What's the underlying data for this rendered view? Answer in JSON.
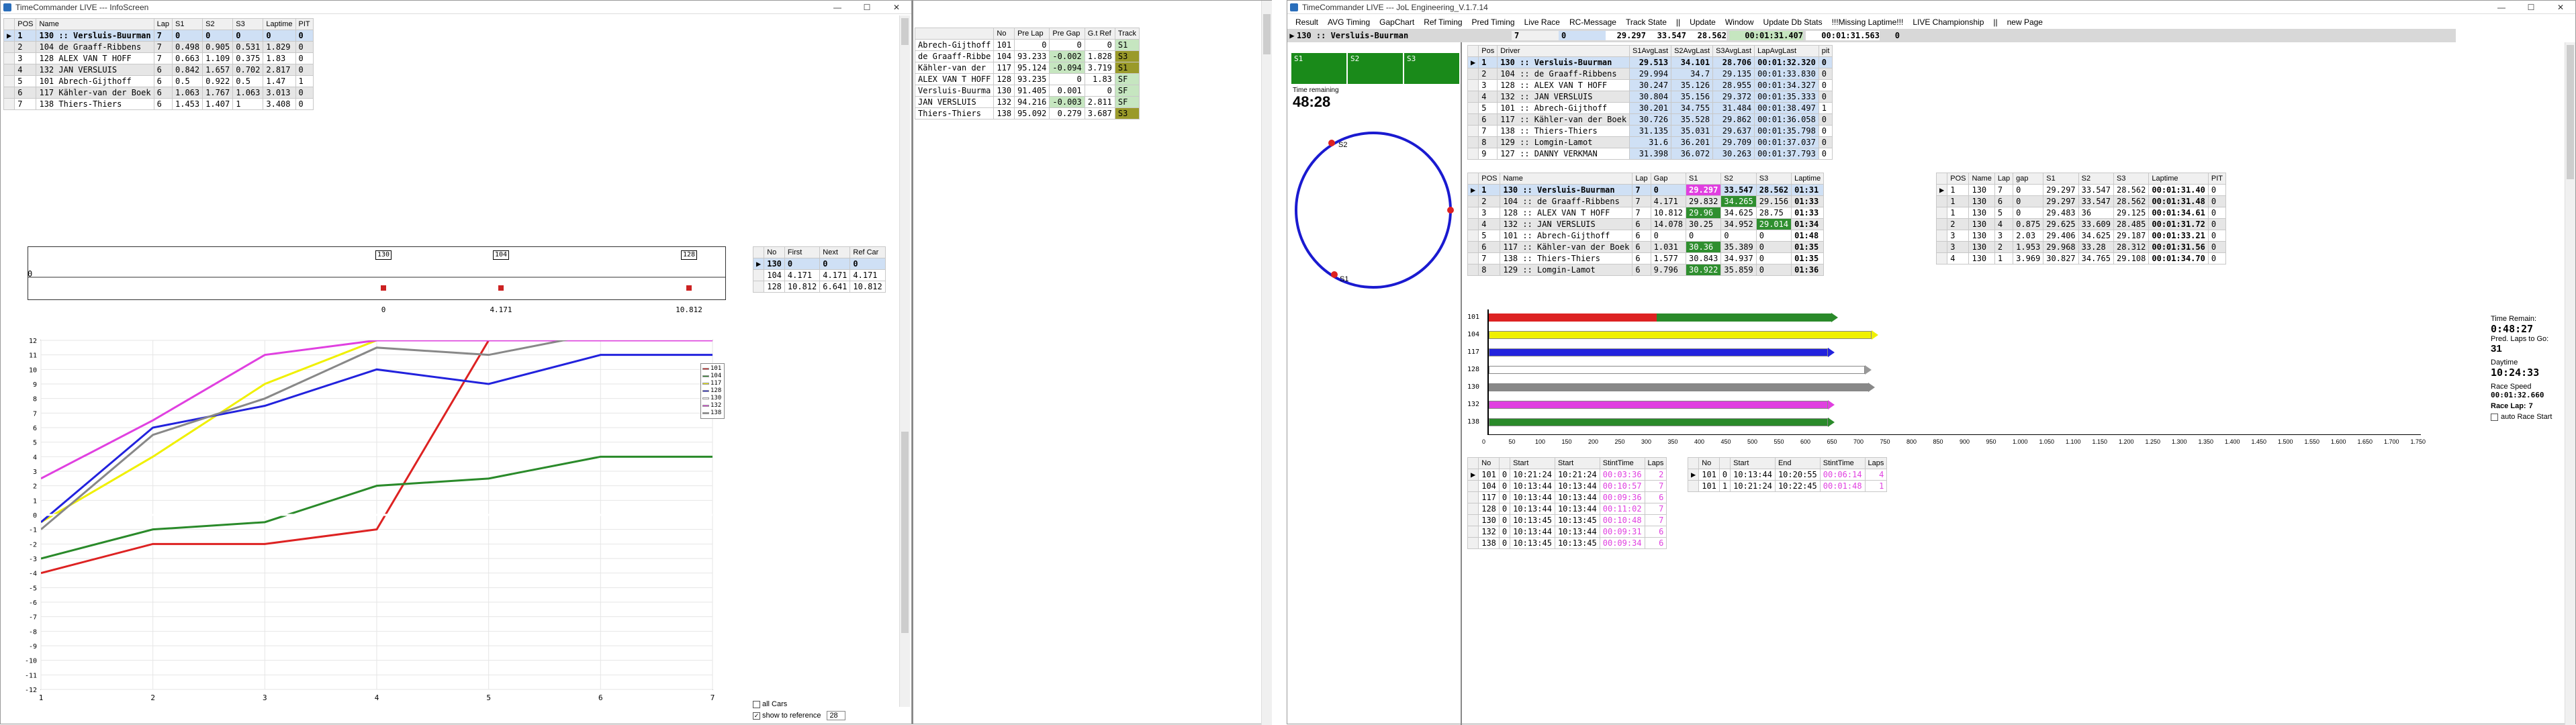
{
  "left_window": {
    "title": "TimeCommander LIVE --- InfoScreen",
    "results_headers": [
      "POS",
      "Name",
      "Lap",
      "S1",
      "S2",
      "S3",
      "Laptime",
      "PIT"
    ],
    "results_rows": [
      [
        "1",
        "130 :: Versluis-Buurman",
        "7",
        "0",
        "0",
        "0",
        "0",
        "0"
      ],
      [
        "2",
        "104 de Graaff-Ribbens",
        "7",
        "0.498",
        "0.905",
        "0.531",
        "1.829",
        "0"
      ],
      [
        "3",
        "128 ALEX VAN T HOFF",
        "7",
        "0.663",
        "1.109",
        "0.375",
        "1.83",
        "0"
      ],
      [
        "4",
        "132 JAN VERSLUIS",
        "6",
        "0.842",
        "1.657",
        "0.702",
        "2.817",
        "0"
      ],
      [
        "5",
        "101 Abrech-Gijthoff",
        "6",
        "0.5",
        "0.922",
        "0.5",
        "1.47",
        "1"
      ],
      [
        "6",
        "117 Kähler-van der Boek",
        "6",
        "1.063",
        "1.767",
        "1.063",
        "3.013",
        "0"
      ],
      [
        "7",
        "138 Thiers-Thiers",
        "6",
        "1.453",
        "1.407",
        "1",
        "3.408",
        "0"
      ]
    ],
    "gap_headers": [
      "No",
      "First",
      "Next",
      "Ref Car"
    ],
    "gap_rows": [
      [
        "130",
        "0",
        "0",
        "0"
      ],
      [
        "104",
        "4.171",
        "4.171",
        "4.171"
      ],
      [
        "128",
        "10.812",
        "6.641",
        "10.812"
      ]
    ],
    "gap_axis_labels": [
      "0",
      "4.171",
      "10.812"
    ],
    "gap_box_labels": [
      "130",
      "104",
      "128"
    ],
    "gap_left_label": "0",
    "all_cars_label": "all Cars",
    "show_ref_label": "show to reference",
    "ref_value": "28"
  },
  "chart_data": {
    "type": "line",
    "x": [
      1,
      2,
      3,
      4,
      5,
      6,
      7
    ],
    "xticks": [
      "1",
      "2",
      "3",
      "4",
      "5",
      "6",
      "7"
    ],
    "ylim": [
      -12,
      12
    ],
    "yticks": [
      "12",
      "11",
      "10",
      "9",
      "8",
      "7",
      "6",
      "5",
      "4",
      "3",
      "2",
      "1",
      "0",
      "-1",
      "-2",
      "-3",
      "-4",
      "-5",
      "-6",
      "-7",
      "-8",
      "-9",
      "-10",
      "-11",
      "-12"
    ],
    "series": [
      {
        "name": "101",
        "color": "#dd2222",
        "values": [
          -4,
          -2,
          -2,
          -1,
          12,
          12,
          12
        ]
      },
      {
        "name": "104",
        "color": "#2a8a2a",
        "values": [
          -3,
          -1,
          -0.5,
          2,
          2.5,
          4,
          4
        ]
      },
      {
        "name": "117",
        "color": "#f0f000",
        "values": [
          -0.5,
          4,
          9,
          12,
          12,
          12,
          12
        ]
      },
      {
        "name": "128",
        "color": "#2222dd",
        "values": [
          -0.5,
          6,
          7.5,
          10,
          9,
          11,
          11
        ]
      },
      {
        "name": "130",
        "color": "#ffffff",
        "values": [
          0,
          0,
          0,
          0,
          0,
          0,
          0
        ]
      },
      {
        "name": "132",
        "color": "#e040e0",
        "values": [
          2.5,
          6.5,
          11,
          12,
          12,
          12,
          12
        ]
      },
      {
        "name": "138",
        "color": "#888888",
        "values": [
          -1,
          5.5,
          8,
          11.5,
          11,
          12.5,
          12.5
        ]
      }
    ]
  },
  "middle": {
    "headers": [
      "",
      "No",
      "Pre Lap",
      "Pre Gap",
      "G.t Ref",
      "Track"
    ],
    "rows": [
      [
        "Abrech-Gijthoff",
        "101",
        "0",
        "0",
        "0",
        "S1"
      ],
      [
        "de Graaff-Ribbe",
        "104",
        "93.233",
        "-0.002",
        "1.828",
        "S3"
      ],
      [
        "Kähler-van der",
        "117",
        "95.124",
        "-0.094",
        "3.719",
        "S1"
      ],
      [
        "ALEX VAN T HOFF",
        "128",
        "93.235",
        "0",
        "1.83",
        "SF"
      ],
      [
        "Versluis-Buurma",
        "130",
        "91.405",
        "0.001",
        "0",
        "SF"
      ],
      [
        "JAN VERSLUIS",
        "132",
        "94.216",
        "-0.003",
        "2.811",
        "SF"
      ],
      [
        "Thiers-Thiers",
        "138",
        "95.092",
        "0.279",
        "3.687",
        "S3"
      ]
    ]
  },
  "right_window": {
    "title": "TimeCommander LIVE --- JoL Engineering_V.1.7.14",
    "menu": [
      "Result",
      "AVG Timing",
      "GapChart",
      "Ref Timing",
      "Pred Timing",
      "Live Race",
      "RC-Message",
      "Track State",
      "||",
      "Update",
      "Window",
      "Update Db Stats",
      "!!!Missing Laptime!!!",
      "LIVE Championship",
      "||",
      "new Page"
    ],
    "leader_bar": {
      "driver": "130 :: Versluis-Buurman",
      "lap": "7",
      "gap": "0",
      "s1": "29.297",
      "s2": "33.547",
      "s3": "28.562",
      "last": "00:01:31.407",
      "best": "00:01:31.563",
      "extra": "0"
    },
    "sector_labels": [
      "S1",
      "S2",
      "S3"
    ],
    "time_remaining_label": "Time remaining",
    "time_remaining": "48:28",
    "track_labels": [
      "S2",
      "S1"
    ],
    "avg_headers": [
      "Pos",
      "Driver",
      "S1AvgLast",
      "S2AvgLast",
      "S3AvgLast",
      "LapAvgLast",
      "pit"
    ],
    "avg_rows": [
      [
        "1",
        "130 :: Versluis-Buurman",
        "29.513",
        "34.101",
        "28.706",
        "00:01:32.320",
        "0"
      ],
      [
        "2",
        "104 :: de Graaff-Ribbens",
        "29.994",
        "34.7",
        "29.135",
        "00:01:33.830",
        "0"
      ],
      [
        "3",
        "128 :: ALEX VAN T HOFF",
        "30.247",
        "35.126",
        "28.955",
        "00:01:34.327",
        "0"
      ],
      [
        "4",
        "132 :: JAN VERSLUIS",
        "30.804",
        "35.156",
        "29.372",
        "00:01:35.333",
        "0"
      ],
      [
        "5",
        "101 :: Abrech-Gijthoff",
        "30.201",
        "34.755",
        "31.484",
        "00:01:38.497",
        "1"
      ],
      [
        "6",
        "117 :: Kähler-van der Boek",
        "30.726",
        "35.528",
        "29.862",
        "00:01:36.058",
        "0"
      ],
      [
        "7",
        "138 :: Thiers-Thiers",
        "31.135",
        "35.031",
        "29.637",
        "00:01:35.798",
        "0"
      ],
      [
        "8",
        "129 :: Lomgin-Lamot",
        "31.6",
        "36.201",
        "29.709",
        "00:01:37.037",
        "0"
      ],
      [
        "9",
        "127 :: DANNY VERKMAN",
        "31.398",
        "36.072",
        "30.263",
        "00:01:37.793",
        "0"
      ]
    ],
    "class_headers": [
      "POS",
      "Name",
      "Lap",
      "Gap",
      "S1",
      "S2",
      "S3",
      "Laptime"
    ],
    "class_rows": [
      [
        "1",
        "130 :: Versluis-Buurman",
        "7",
        "0",
        "29.297",
        "33.547",
        "28.562",
        "01:31"
      ],
      [
        "2",
        "104 :: de Graaff-Ribbens",
        "7",
        "4.171",
        "29.832",
        "34.265",
        "29.156",
        "01:33"
      ],
      [
        "3",
        "128 :: ALEX VAN T HOFF",
        "7",
        "10.812",
        "29.96",
        "34.625",
        "28.75",
        "01:33"
      ],
      [
        "4",
        "132 :: JAN VERSLUIS",
        "6",
        "14.078",
        "30.25",
        "34.952",
        "29.014",
        "01:34"
      ],
      [
        "5",
        "101 :: Abrech-Gijthoff",
        "6",
        "0",
        "0",
        "0",
        "0",
        "01:48"
      ],
      [
        "6",
        "117 :: Kähler-van der Boek",
        "6",
        "1.031",
        "30.36",
        "35.389",
        "0",
        "01:35"
      ],
      [
        "7",
        "138 :: Thiers-Thiers",
        "6",
        "1.577",
        "30.843",
        "34.937",
        "0",
        "01:35"
      ],
      [
        "8",
        "129 :: Lomgin-Lamot",
        "6",
        "9.796",
        "30.922",
        "35.859",
        "0",
        "01:36"
      ]
    ],
    "car_headers": [
      "POS",
      "Name",
      "Lap",
      "gap",
      "S1",
      "S2",
      "S3",
      "Laptime",
      "PIT"
    ],
    "car_rows": [
      [
        "1",
        "130",
        "7",
        "0",
        "29.297",
        "33.547",
        "28.562",
        "00:01:31.40",
        "0"
      ],
      [
        "1",
        "130",
        "6",
        "0",
        "29.297",
        "33.547",
        "28.562",
        "00:01:31.48",
        "0"
      ],
      [
        "1",
        "130",
        "5",
        "0",
        "29.483",
        "36",
        "29.125",
        "00:01:34.61",
        "0"
      ],
      [
        "2",
        "130",
        "4",
        "0.875",
        "29.625",
        "33.609",
        "28.485",
        "00:01:31.72",
        "0"
      ],
      [
        "3",
        "130",
        "3",
        "2.03",
        "29.406",
        "34.625",
        "29.187",
        "00:01:33.21",
        "0"
      ],
      [
        "3",
        "130",
        "2",
        "1.953",
        "29.968",
        "33.28",
        "28.312",
        "00:01:31.56",
        "0"
      ],
      [
        "4",
        "130",
        "1",
        "3.969",
        "30.827",
        "34.765",
        "29.108",
        "00:01:34.70",
        "0"
      ]
    ],
    "bar_labels": [
      "101",
      "104",
      "117",
      "128",
      "130",
      "132",
      "138"
    ],
    "bar_axis": [
      "0",
      "50",
      "100",
      "150",
      "200",
      "250",
      "300",
      "350",
      "400",
      "450",
      "500",
      "550",
      "600",
      "650",
      "700",
      "750",
      "800",
      "850",
      "900",
      "950",
      "1.000",
      "1.050",
      "1.100",
      "1.150",
      "1.200",
      "1.250",
      "1.300",
      "1.350",
      "1.400",
      "1.450",
      "1.500",
      "1.550",
      "1.600",
      "1.650",
      "1.700",
      "1.750"
    ],
    "side_info": {
      "time_remain_label": "Time Remain:",
      "time_remain": "0:48:27",
      "pred_laps_label": "Pred. Laps to Go:",
      "pred_laps": "31",
      "daytime_label": "Daytime",
      "daytime": "10:24:33",
      "race_speed_label": "Race Speed",
      "race_speed": "00:01:32.660",
      "race_lap_label": "Race Lap:",
      "race_lap": "7",
      "auto_race_start": "auto Race Start"
    },
    "pit_headers": [
      "No",
      "",
      "Start",
      "Start",
      "StintTime",
      "Laps"
    ],
    "pit_rows": [
      [
        "101",
        "0",
        "10:21:24",
        "10:21:24",
        "00:03:36",
        "2"
      ],
      [
        "104",
        "0",
        "10:13:44",
        "10:13:44",
        "00:10:57",
        "7"
      ],
      [
        "117",
        "0",
        "10:13:44",
        "10:13:44",
        "00:09:36",
        "6"
      ],
      [
        "128",
        "0",
        "10:13:44",
        "10:13:44",
        "00:11:02",
        "7"
      ],
      [
        "130",
        "0",
        "10:13:45",
        "10:13:45",
        "00:10:48",
        "7"
      ],
      [
        "132",
        "0",
        "10:13:44",
        "10:13:44",
        "00:09:31",
        "6"
      ],
      [
        "138",
        "0",
        "10:13:45",
        "10:13:45",
        "00:09:34",
        "6"
      ]
    ],
    "stint_headers": [
      "No",
      "",
      "Start",
      "End",
      "StintTime",
      "Laps"
    ],
    "stint_rows": [
      [
        "101",
        "0",
        "10:13:44",
        "10:20:55",
        "00:06:14",
        "4"
      ],
      [
        "101",
        "1",
        "10:21:24",
        "10:22:45",
        "00:01:48",
        "1"
      ]
    ]
  }
}
